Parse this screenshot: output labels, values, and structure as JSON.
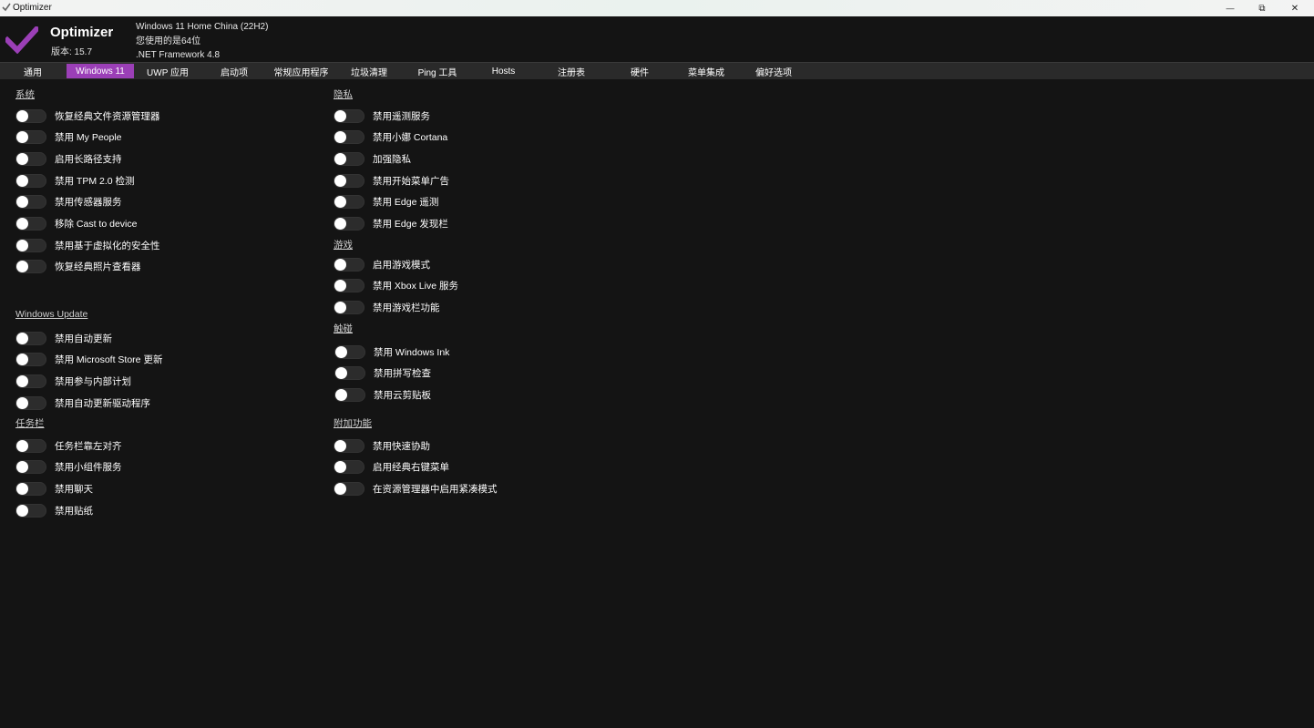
{
  "window": {
    "title": "Optimizer",
    "controls": {
      "minimize": "—",
      "restore": "⧉",
      "close": "✕"
    }
  },
  "brand": {
    "name": "Optimizer",
    "version": "版本: 15.7",
    "accent": "#9b3fb7"
  },
  "sysinfo": {
    "os": "Windows 11 Home China (22H2)",
    "arch": "您使用的是64位",
    "framework": ".NET Framework 4.8"
  },
  "tabs": [
    {
      "label": "通用"
    },
    {
      "label": "Windows 11",
      "active": true
    },
    {
      "label": "UWP 应用"
    },
    {
      "label": "启动项"
    },
    {
      "label": "常规应用程序"
    },
    {
      "label": "垃圾清理"
    },
    {
      "label": "Ping 工具"
    },
    {
      "label": "Hosts"
    },
    {
      "label": "注册表"
    },
    {
      "label": "硬件"
    },
    {
      "label": "菜单集成"
    },
    {
      "label": "偏好选项"
    }
  ],
  "sections": [
    {
      "title": "系统",
      "items": [
        {
          "label": "恢复经典文件资源管理器",
          "on": false
        },
        {
          "label": "禁用 My People",
          "on": false
        },
        {
          "label": "启用长路径支持",
          "on": false
        },
        {
          "label": "禁用 TPM 2.0 检测",
          "on": false
        },
        {
          "label": "禁用传感器服务",
          "on": false
        },
        {
          "label": "移除 Cast to device",
          "on": false
        },
        {
          "label": "禁用基于虚拟化的安全性",
          "on": false
        },
        {
          "label": "恢复经典照片查看器",
          "on": false
        }
      ]
    },
    {
      "title": "Windows Update",
      "items": [
        {
          "label": "禁用自动更新",
          "on": false
        },
        {
          "label": "禁用 Microsoft Store 更新",
          "on": false
        },
        {
          "label": "禁用参与内部计划",
          "on": false
        },
        {
          "label": "禁用自动更新驱动程序",
          "on": false
        }
      ]
    },
    {
      "title": "任务栏",
      "items": [
        {
          "label": "任务栏靠左对齐",
          "on": false
        },
        {
          "label": "禁用小组件服务",
          "on": false
        },
        {
          "label": "禁用聊天",
          "on": false
        },
        {
          "label": "禁用贴纸",
          "on": false
        }
      ]
    },
    {
      "title": "隐私",
      "items": [
        {
          "label": "禁用遥测服务",
          "on": false
        },
        {
          "label": "禁用小娜 Cortana",
          "on": false
        },
        {
          "label": "加强隐私",
          "on": false
        },
        {
          "label": "禁用开始菜单广告",
          "on": false
        },
        {
          "label": "禁用 Edge 遥测",
          "on": false
        },
        {
          "label": "禁用 Edge 发现栏",
          "on": false
        }
      ]
    },
    {
      "title": "游戏",
      "items": [
        {
          "label": "启用游戏模式",
          "on": false
        },
        {
          "label": "禁用 Xbox Live 服务",
          "on": false
        },
        {
          "label": "禁用游戏栏功能",
          "on": false
        }
      ]
    },
    {
      "title": "触碰",
      "items": [
        {
          "label": "禁用 Windows Ink",
          "on": false
        },
        {
          "label": "禁用拼写检查",
          "on": false
        },
        {
          "label": "禁用云剪贴板",
          "on": false
        }
      ]
    },
    {
      "title": "附加功能",
      "items": [
        {
          "label": "禁用快速协助",
          "on": false
        },
        {
          "label": "启用经典右键菜单",
          "on": false
        },
        {
          "label": "在资源管理器中启用紧凑模式",
          "on": false
        }
      ]
    }
  ]
}
